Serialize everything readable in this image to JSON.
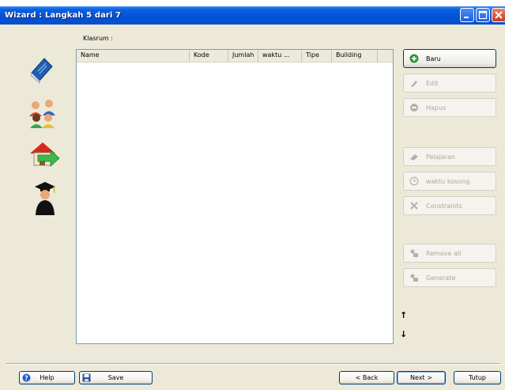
{
  "window": {
    "title": "Wizard : Langkah 5 dari 7"
  },
  "list": {
    "label": "Klasrum :",
    "columns": [
      "Name",
      "Kode",
      "Jumlah",
      "waktu ...",
      "Tipe",
      "Building"
    ]
  },
  "side_icons": [
    "book-icon",
    "users-icon",
    "house-arrow-icon",
    "graduate-icon"
  ],
  "actions": {
    "baru": "Baru",
    "edit": "Edit",
    "hapus": "Hapus",
    "pelajaran": "Pelajaran",
    "waktu_kosong": "waktu kosong",
    "constraints": "Constraints",
    "remove_all": "Remove all",
    "generate": "Generate"
  },
  "arrows": {
    "up": "↑",
    "down": "↓"
  },
  "footer": {
    "help": "Help",
    "save": "Save",
    "back": "< Back",
    "next": "Next >",
    "tutup": "Tutup"
  }
}
